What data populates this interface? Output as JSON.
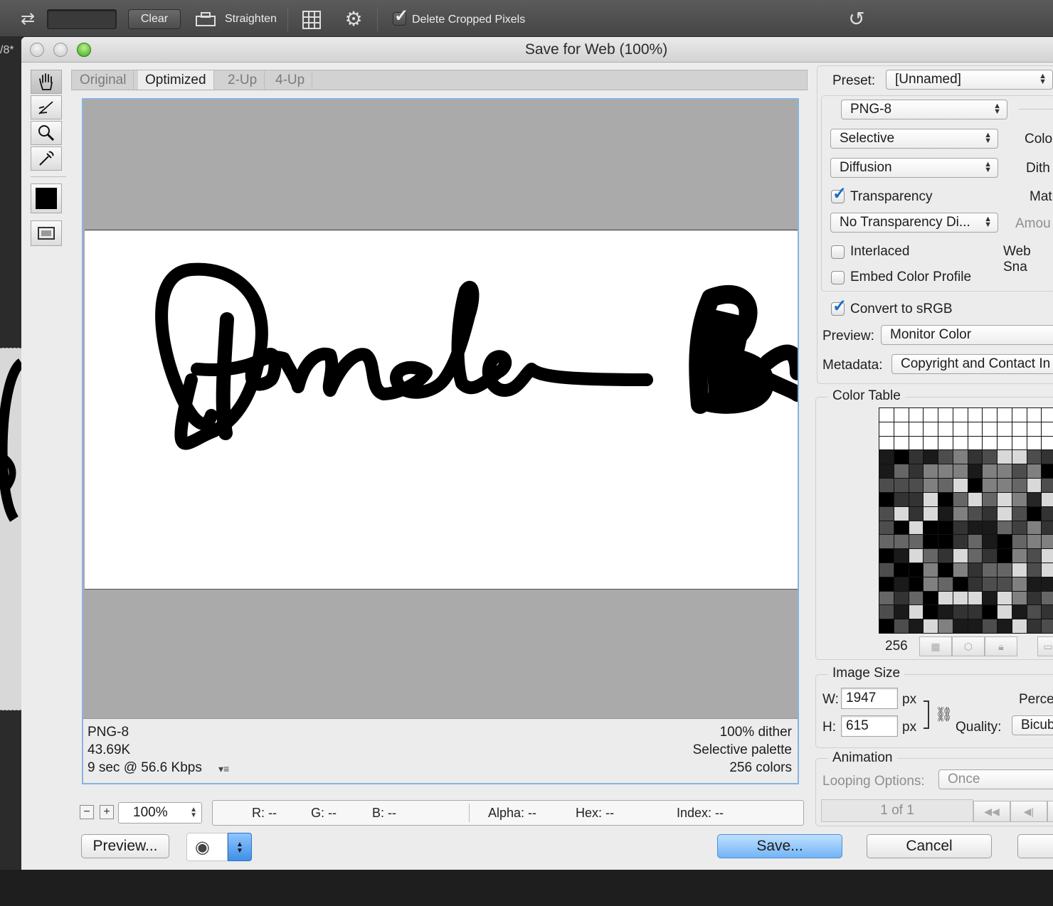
{
  "toolbar": {
    "clear_label": "Clear",
    "straighten_label": "Straighten",
    "delete_cropped_label": "Delete Cropped Pixels",
    "delete_cropped_checked": true,
    "side_tab_text": "/8*"
  },
  "dialog": {
    "title": "Save for Web (100%)",
    "tabs": [
      "Original",
      "Optimized",
      "2-Up",
      "4-Up"
    ],
    "active_tab": "Optimized",
    "tools": [
      "hand-tool-icon",
      "slice-select-tool-icon",
      "zoom-tool-icon",
      "eyedropper-tool-icon"
    ]
  },
  "preview_info": {
    "format": "PNG-8",
    "size": "43.69K",
    "download_time": "9 sec @ 56.6 Kbps",
    "dither": "100% dither",
    "palette": "Selective palette",
    "colors": "256 colors"
  },
  "bottom": {
    "zoom_value": "100%",
    "r": "R: --",
    "g": "G: --",
    "b": "B: --",
    "alpha": "Alpha: --",
    "hex": "Hex: --",
    "index": "Index: --",
    "preview_button": "Preview...",
    "save_button": "Save...",
    "cancel_button": "Cancel"
  },
  "settings": {
    "preset_label": "Preset:",
    "preset_value": "[Unnamed]",
    "format_value": "PNG-8",
    "reduction_value": "Selective",
    "colors_label": "Colo",
    "dither_value": "Diffusion",
    "dither_label": "Dith",
    "transparency_label": "Transparency",
    "transparency_checked": true,
    "matte_label": "Mat",
    "transparency_dither_value": "No Transparency Di...",
    "amount_label": "Amou",
    "interlaced_label": "Interlaced",
    "interlaced_checked": false,
    "web_snap_label": "Web Sna",
    "embed_profile_label": "Embed Color Profile",
    "embed_profile_checked": false,
    "convert_srgb_label": "Convert to sRGB",
    "convert_srgb_checked": true,
    "preview_label": "Preview:",
    "preview_value": "Monitor Color",
    "metadata_label": "Metadata:",
    "metadata_value": "Copyright and Contact In"
  },
  "color_table": {
    "title": "Color Table",
    "count": "256"
  },
  "image_size": {
    "title": "Image Size",
    "w_label": "W:",
    "w_value": "1947",
    "h_label": "H:",
    "h_value": "615",
    "unit": "px",
    "percent_label": "Perce",
    "quality_label": "Quality:",
    "quality_value": "Bicub"
  },
  "animation": {
    "title": "Animation",
    "looping_label": "Looping Options:",
    "looping_value": "Once",
    "frame_counter": "1 of 1"
  }
}
